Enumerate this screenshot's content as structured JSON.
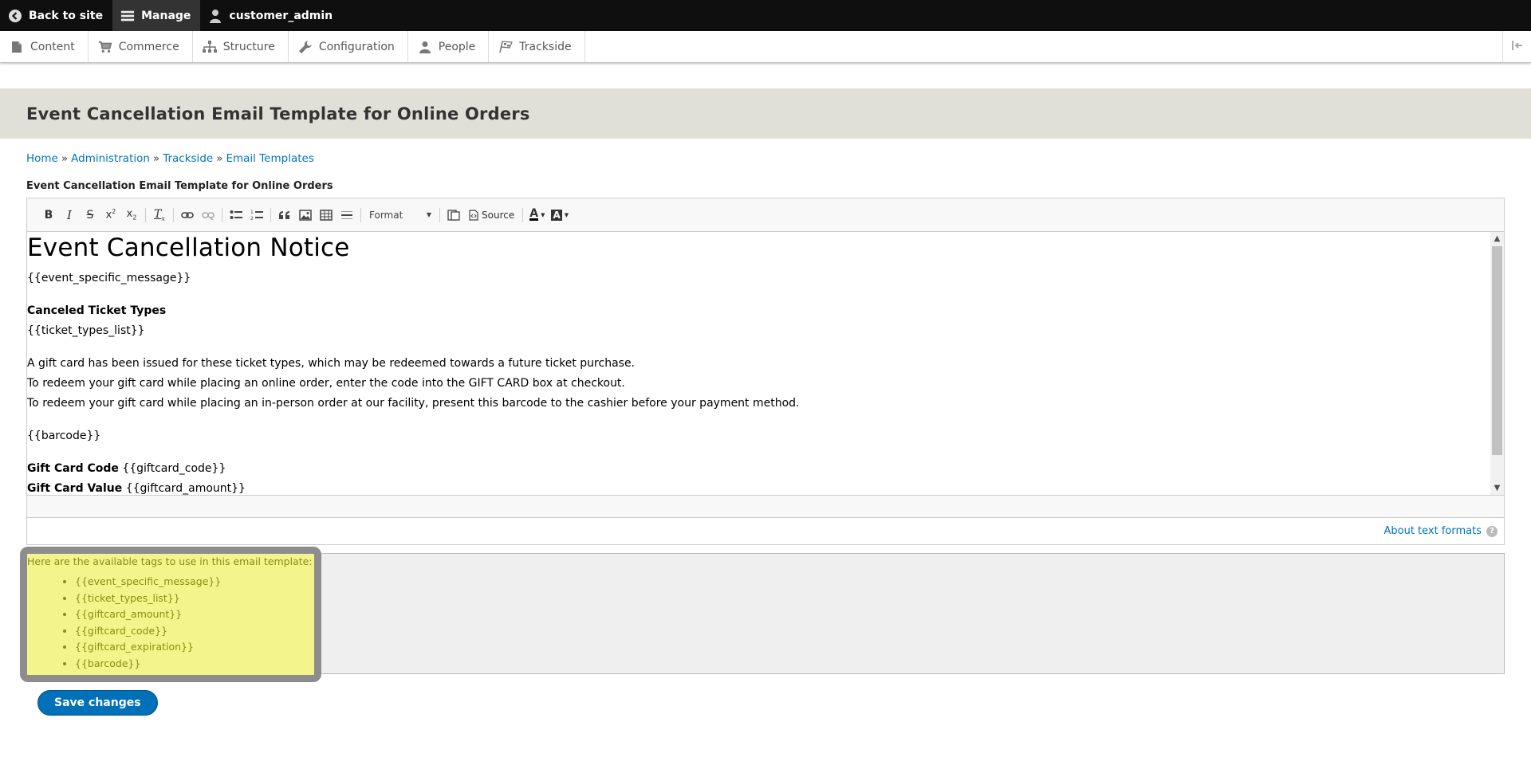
{
  "toolbar": {
    "back_to_site": "Back to site",
    "manage": "Manage",
    "user": "customer_admin"
  },
  "tray": {
    "items": [
      {
        "label": "Content",
        "icon": "page-icon"
      },
      {
        "label": "Commerce",
        "icon": "cart-icon"
      },
      {
        "label": "Structure",
        "icon": "sitemap-icon"
      },
      {
        "label": "Configuration",
        "icon": "wrench-icon"
      },
      {
        "label": "People",
        "icon": "person-icon"
      },
      {
        "label": "Trackside",
        "icon": "checkered-flag-icon"
      }
    ]
  },
  "page": {
    "title": "Event Cancellation Email Template for Online Orders"
  },
  "breadcrumb": [
    {
      "label": "Home"
    },
    {
      "label": "Administration"
    },
    {
      "label": "Trackside"
    },
    {
      "label": "Email Templates"
    }
  ],
  "breadcrumb_separator": "»",
  "field": {
    "label": "Event Cancellation Email Template for Online Orders"
  },
  "editor_toolbar": {
    "format_label": "Format",
    "source_label": "Source"
  },
  "editor_content": {
    "heading": "Event Cancellation Notice",
    "event_message": "{{event_specific_message}}",
    "ticket_heading": "Canceled Ticket Types",
    "ticket_list": "{{ticket_types_list}}",
    "gift_line1": "A gift card has been issued for these ticket types, which may be redeemed towards a future ticket purchase.",
    "gift_line2": "To redeem your gift card while placing an online order, enter the code into the GIFT CARD box at checkout.",
    "gift_line3": "To redeem your gift card while placing an in-person order at our facility, present this barcode to the cashier before your payment method.",
    "barcode": "{{barcode}}",
    "code_label": "Gift Card Code",
    "code_value": " {{giftcard_code}}",
    "value_label": "Gift Card Value",
    "value_value": " {{giftcard_amount}}"
  },
  "format": {
    "about_link": "About text formats",
    "help_icon": "?"
  },
  "tags": {
    "intro": "Here are the available tags to use in this email template:",
    "items": [
      "{{event_specific_message}}",
      "{{ticket_types_list}}",
      "{{giftcard_amount}}",
      "{{giftcard_code}}",
      "{{giftcard_expiration}}",
      "{{barcode}}"
    ]
  },
  "actions": {
    "save_label": "Save changes"
  },
  "colors": {
    "link": "#0074bd",
    "button": "#0071b8",
    "highlight": "#f3f58c"
  }
}
